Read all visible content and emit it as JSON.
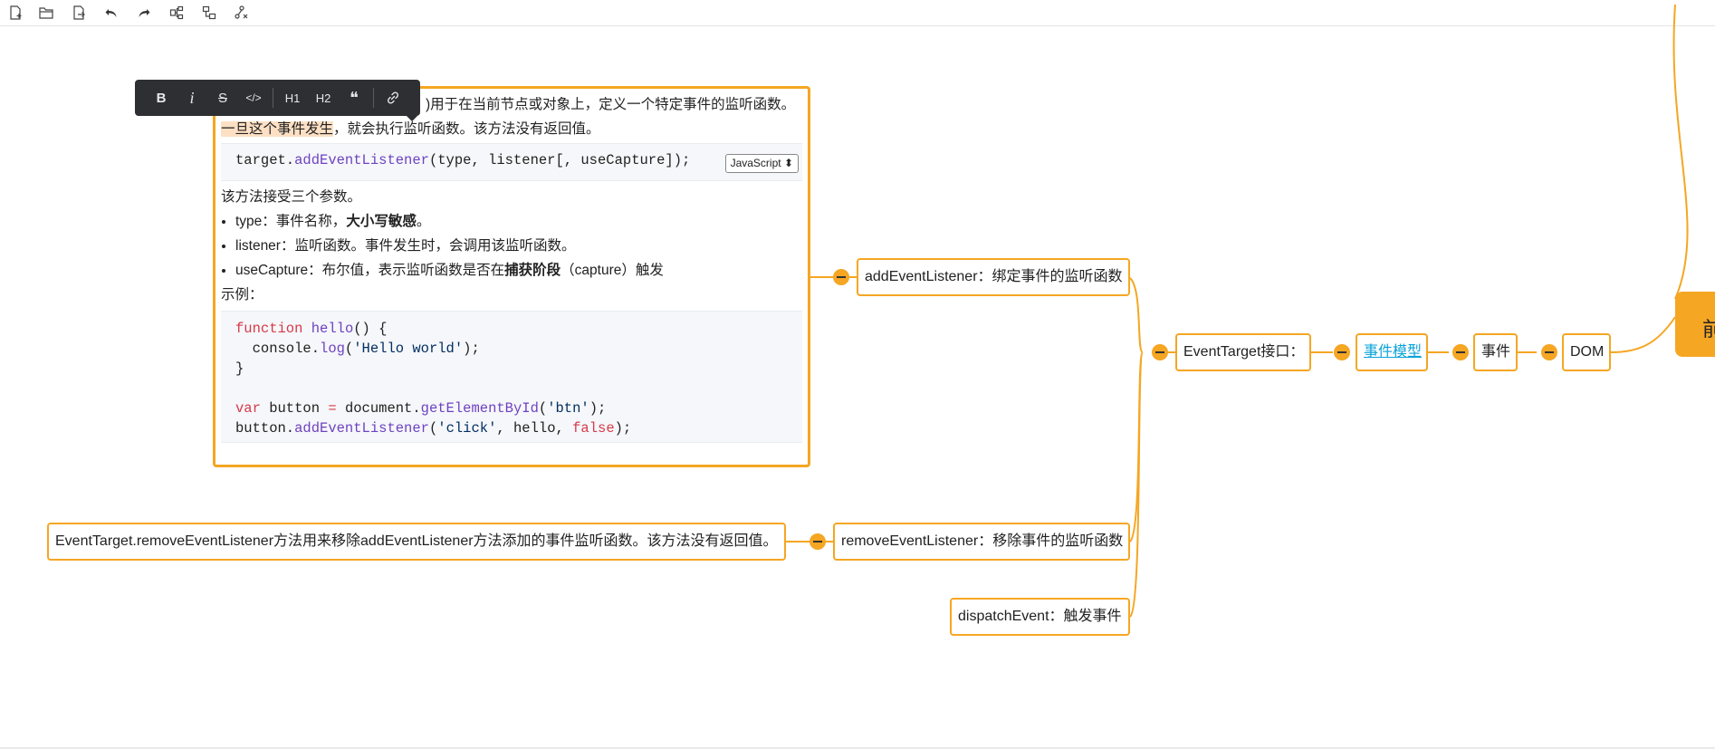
{
  "toolbar": {
    "items": [
      {
        "name": "new-file-icon"
      },
      {
        "name": "open-folder-icon"
      },
      {
        "name": "export-icon"
      },
      {
        "name": "undo-icon"
      },
      {
        "name": "redo-icon"
      },
      {
        "name": "add-child-node-icon"
      },
      {
        "name": "add-sibling-node-icon"
      },
      {
        "name": "delete-node-icon"
      }
    ]
  },
  "format_bar": {
    "bold": "B",
    "italic": "i",
    "strike": "S",
    "code": "</>",
    "h1": "H1",
    "h2": "H2",
    "quote": "❝",
    "link_icon": "link-icon"
  },
  "nodes": {
    "root": "前",
    "dom": "DOM",
    "event": "事件",
    "event_model": "事件模型",
    "event_target": "EventTarget接口：",
    "add_listener": "addEventListener：绑定事件的监听函数",
    "remove_listener": "removeEventListener：移除事件的监听函数",
    "dispatch_event": "dispatchEvent：触发事件",
    "remove_desc": "EventTarget.removeEventListener方法用来移除addEventListener方法添加的事件监听函数。该方法没有返回值。"
  },
  "editor": {
    "line1": ")用于在当前节点或对象上，定义一个特定事件的监听函数。",
    "line2_highlight": "一旦这个事件发生",
    "line2_rest": "，就会执行监听函数。该方法没有返回值。",
    "signature": {
      "target": "target.",
      "method": "addEventListener",
      "args": "(type, listener[, useCapture]);"
    },
    "language": "JavaScript",
    "params_intro": "该方法接受三个参数。",
    "params": [
      {
        "label": "type：事件名称，",
        "bold": "大小写敏感",
        "tail": "。"
      },
      {
        "label": "listener：监听函数。事件发生时，会调用该监听函数。",
        "bold": "",
        "tail": ""
      },
      {
        "label": "useCapture：布尔值，表示监听函数是否在",
        "bold": "捕获阶段",
        "tail": "（capture）触发"
      }
    ],
    "example_label": "示例：",
    "code": {
      "l1_kw": "function",
      "l1_fn": "hello",
      "l1_rest": "() {",
      "l2_pre": "  console.",
      "l2_fn": "log",
      "l2_open": "(",
      "l2_str": "'Hello world'",
      "l2_close": ");",
      "l3": "}",
      "l5_kw": "var",
      "l5_mid": " button ",
      "l5_eq": "=",
      "l5_pre": " document.",
      "l5_fn": "getElementById",
      "l5_open": "(",
      "l5_str": "'btn'",
      "l5_close": ");",
      "l6_pre": "button.",
      "l6_fn": "addEventListener",
      "l6_open": "(",
      "l6_str": "'click'",
      "l6_mid": ", hello, ",
      "l6_kw": "false",
      "l6_close": ");"
    }
  },
  "colors": {
    "accent": "#f5a623",
    "link": "#0aa3d8",
    "highlight": "#fde0c4",
    "format_bar_bg": "#2d2f33"
  }
}
